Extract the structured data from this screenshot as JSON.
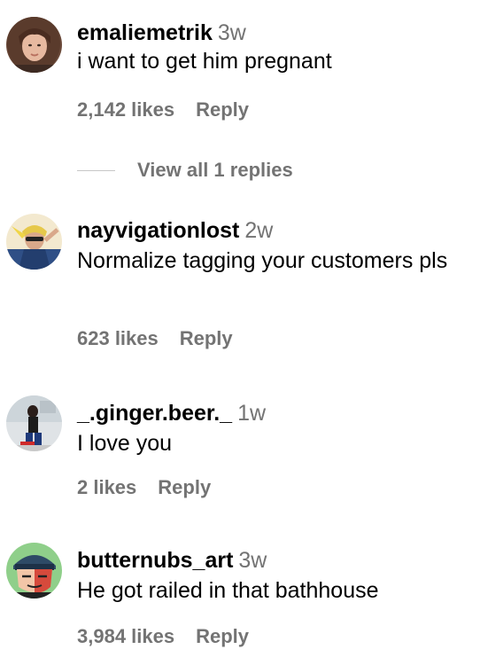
{
  "comments": [
    {
      "username": "emaliemetrik",
      "time": "3w",
      "text": "i want to get him pregnant",
      "likes": "2,142 likes",
      "reply": "Reply",
      "view_replies": "View all 1 replies"
    },
    {
      "username": "nayvigationlost",
      "time": "2w",
      "text": "Normalize tagging your customers pls",
      "likes": "623 likes",
      "reply": "Reply"
    },
    {
      "username": "_.ginger.beer._",
      "time": "1w",
      "text": "I love you",
      "likes": "2 likes",
      "reply": "Reply"
    },
    {
      "username": "butternubs_art",
      "time": "3w",
      "text": "He got railed in that bathhouse",
      "likes": "3,984 likes",
      "reply": "Reply"
    }
  ]
}
